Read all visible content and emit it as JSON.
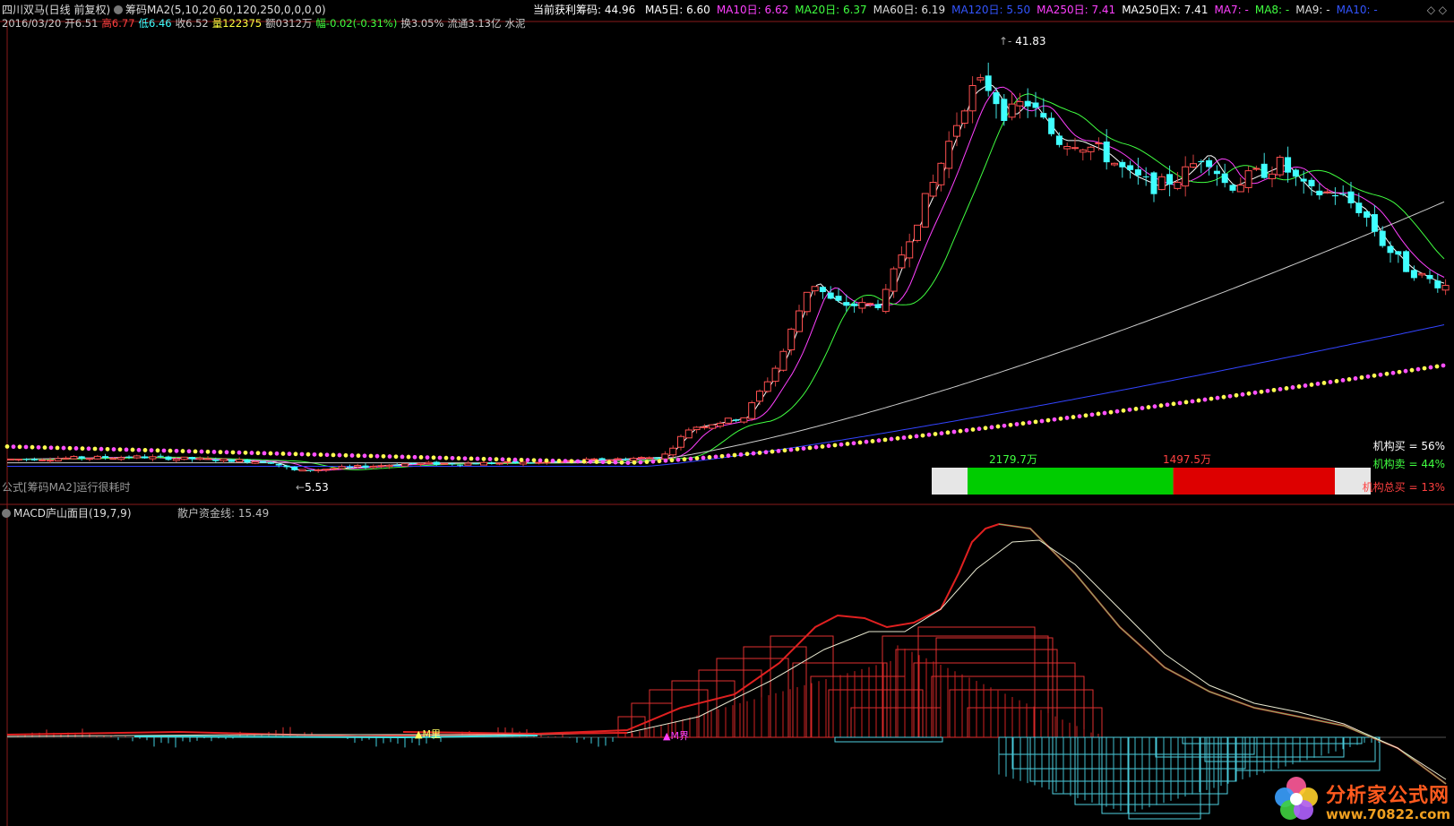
{
  "header": {
    "stock": "四川双马(日线 前复权)",
    "indicator": "筹码MA2(5,10,20,60,120,250,0,0,0,0)",
    "profit_label": "当前获利筹码: 44.96",
    "ma_items": [
      {
        "text": "MA5日: 6.60",
        "color": "#ffffff"
      },
      {
        "text": "MA10日: 6.62",
        "color": "#ff40ff"
      },
      {
        "text": "MA20日: 6.37",
        "color": "#40ff40"
      },
      {
        "text": "MA60日: 6.19",
        "color": "#dddddd"
      },
      {
        "text": "MA120日: 5.50",
        "color": "#3355ff"
      },
      {
        "text": "MA250日: 7.41",
        "color": "#ff40ff"
      },
      {
        "text": "MA250日X: 7.41",
        "color": "#ffffff"
      },
      {
        "text": "MA7: -",
        "color": "#ff40ff"
      },
      {
        "text": "MA8: -",
        "color": "#40ff40"
      },
      {
        "text": "MA9: -",
        "color": "#dddddd"
      },
      {
        "text": "MA10: -",
        "color": "#3355ff"
      }
    ],
    "ohlc_items": [
      {
        "text": "2016/03/20",
        "color": "#cccccc"
      },
      {
        "text": "开6.51",
        "color": "#cccccc"
      },
      {
        "text": "高6.77",
        "color": "#ff4040"
      },
      {
        "text": "低6.46",
        "color": "#40ffff"
      },
      {
        "text": "收6.52",
        "color": "#cccccc"
      },
      {
        "text": "量122375",
        "color": "#ffff40"
      },
      {
        "text": "额0312万",
        "color": "#cccccc"
      },
      {
        "text": "幅-0.02(-0.31%)",
        "color": "#40ff40"
      },
      {
        "text": "换3.05%",
        "color": "#cccccc"
      },
      {
        "text": "流通3.13亿",
        "color": "#cccccc"
      },
      {
        "text": "水泥",
        "color": "#cccccc"
      }
    ],
    "window_icons": "◇ ◇"
  },
  "main": {
    "formula_text": "公式[筹码MA2]运行很耗时",
    "max_label": "41.83",
    "min_label": "5.53"
  },
  "institution": {
    "buy_amount": "2179.7万",
    "sell_amount": "1497.5万",
    "buy_label": "机构买 = 56%",
    "sell_label": "机构卖 = 44%",
    "total_label": "机构总买 = 13%",
    "buy_pct": 56,
    "sell_pct": 44,
    "colors": {
      "buy": "#00cc00",
      "sell": "#dd0000",
      "gray": "#e6e6e6"
    }
  },
  "macd": {
    "title": "MACD庐山面目(19,7,9)",
    "retail_line": "散户资金线: 15.49",
    "signal_1": "▲M里",
    "signal_2": "▲M界"
  },
  "logo": {
    "title": "分析家公式网",
    "url": "www.70822.com"
  },
  "chart_data": [
    {
      "type": "candlestick",
      "title": "四川双马(日线 前复权)",
      "ylim": [
        4.5,
        43
      ],
      "annotations": [
        {
          "label": "41.83",
          "kind": "max"
        },
        {
          "label": "5.53",
          "kind": "min"
        }
      ],
      "series": [
        {
          "name": "MA5",
          "color": "#ffffff"
        },
        {
          "name": "MA10",
          "color": "#ff40ff"
        },
        {
          "name": "MA20",
          "color": "#40ff40"
        },
        {
          "name": "MA60",
          "color": "#dddddd"
        },
        {
          "name": "MA120",
          "color": "#3355ff"
        },
        {
          "name": "MA250",
          "color": "#ff40ff"
        }
      ],
      "grid": false
    },
    {
      "type": "line",
      "title": "MACD庐山面目(19,7,9)",
      "series": [
        {
          "name": "散户资金线",
          "color": "#dddddd"
        }
      ],
      "grid": false
    }
  ]
}
